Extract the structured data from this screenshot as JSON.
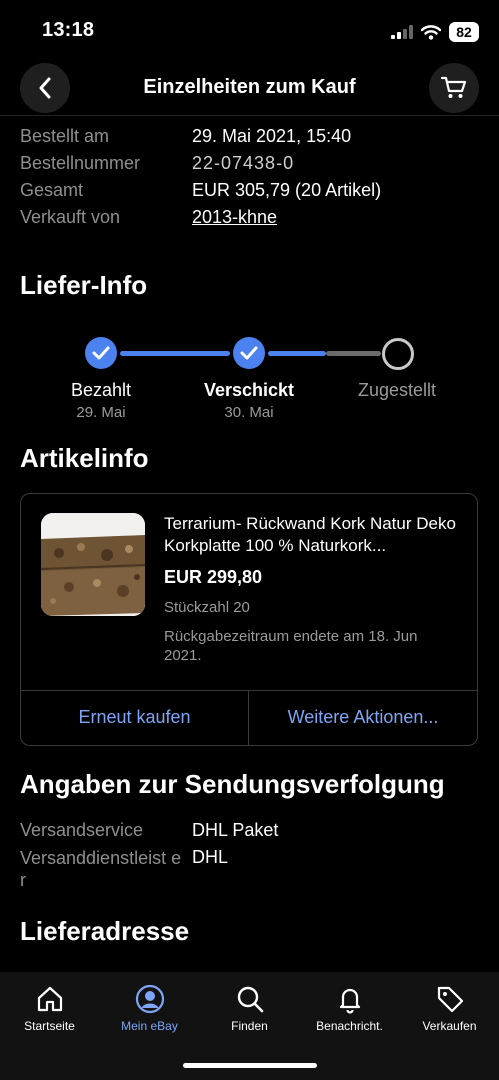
{
  "status_bar": {
    "time": "13:18",
    "battery": "82"
  },
  "header": {
    "title": "Einzelheiten zum Kauf"
  },
  "order_summary": [
    {
      "label": "Bestellt am",
      "value": "29. Mai 2021, 15:40"
    },
    {
      "label": "Bestellnummer",
      "value": "22-07438-0"
    },
    {
      "label": "Gesamt",
      "value": "EUR 305,79 (20 Artikel)"
    },
    {
      "label": "Verkauft von",
      "value": "2013-khne"
    }
  ],
  "delivery": {
    "title": "Liefer-Info",
    "steps": [
      {
        "label": "Bezahlt",
        "date": "29. Mai",
        "done": true
      },
      {
        "label": "Verschickt",
        "date": "30. Mai",
        "done": true
      },
      {
        "label": "Zugestellt",
        "date": "",
        "done": false
      }
    ]
  },
  "item": {
    "section_title": "Artikelinfo",
    "title": "Terrarium- Rückwand  Kork Natur Deko Korkplatte  100 % Naturkork...",
    "price": "EUR 299,80",
    "quantity": "Stückzahl 20",
    "return_note": "Rückgabezeitraum endete am 18. Jun 2021.",
    "actions": {
      "buy_again": "Erneut kaufen",
      "more_actions": "Weitere Aktionen..."
    }
  },
  "tracking": {
    "title": "Angaben zur Sendungsverfolgung",
    "rows": [
      {
        "label": "Versandservice",
        "value": "DHL Paket"
      },
      {
        "label": "Versanddienstleist er",
        "value": "DHL"
      }
    ]
  },
  "address": {
    "title": "Lieferadresse"
  },
  "tabbar": {
    "items": [
      {
        "label": "Startseite",
        "icon": "home-icon",
        "active": false
      },
      {
        "label": "Mein eBay",
        "icon": "profile-icon",
        "active": true
      },
      {
        "label": "Finden",
        "icon": "search-icon",
        "active": false
      },
      {
        "label": "Benachricht.",
        "icon": "bell-icon",
        "active": false
      },
      {
        "label": "Verkaufen",
        "icon": "tag-icon",
        "active": false
      }
    ]
  },
  "colors": {
    "accent": "#4c82ef",
    "link": "#7ea5f5",
    "muted": "#8f8f8f",
    "background": "#000000"
  }
}
